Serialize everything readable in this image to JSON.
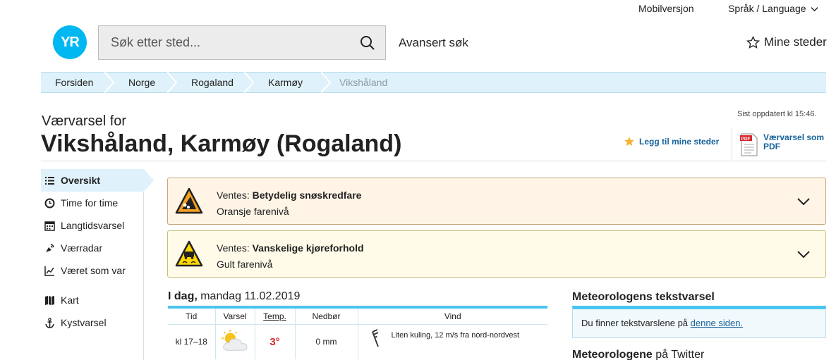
{
  "topbar": {
    "mobile": "Mobilversjon",
    "language": "Språk / Language"
  },
  "header": {
    "logo": "YR",
    "search_placeholder": "Søk etter sted...",
    "advanced_search": "Avansert søk",
    "my_places": "Mine steder"
  },
  "breadcrumb": [
    "Forsiden",
    "Norge",
    "Rogaland",
    "Karmøy",
    "Vikshåland"
  ],
  "title": {
    "prefix": "Værvarsel for",
    "place": "Vikshåland",
    "region": ", Karmøy (Rogaland)",
    "updated": "Sist oppdatert kl 15:46.",
    "add_to_my_places": "Legg til mine steder",
    "pdf": "Værvarsel som PDF"
  },
  "sidebar": {
    "items": [
      {
        "label": "Oversikt",
        "icon": "list-icon"
      },
      {
        "label": "Time for time",
        "icon": "clock-icon"
      },
      {
        "label": "Langtidsvarsel",
        "icon": "calendar-icon"
      },
      {
        "label": "Værradar",
        "icon": "radar-icon"
      },
      {
        "label": "Været som var",
        "icon": "graph-icon"
      },
      {
        "label": "Kart",
        "icon": "map-icon"
      },
      {
        "label": "Kystvarsel",
        "icon": "anchor-icon"
      }
    ]
  },
  "warnings": [
    {
      "prefix": "Ventes: ",
      "title": "Betydelig snøskredfare",
      "level": "Oransje farenivå",
      "icon": "avalanche-warning-icon",
      "color": "#f5a020"
    },
    {
      "prefix": "Ventes: ",
      "title": "Vanskelige kjøreforhold",
      "level": "Gult farenivå",
      "icon": "slippery-road-warning-icon",
      "color": "#ffd700"
    }
  ],
  "forecast": {
    "day_bold": "I dag,",
    "day_rest": " mandag 11.02.2019",
    "headers": [
      "Tid",
      "Varsel",
      "Temp.",
      "Nedbør",
      "Vind"
    ],
    "rows": [
      {
        "time": "kl 17–18",
        "symbol": "partly-cloudy-icon",
        "temp": "3°",
        "precip": "0 mm",
        "wind": "Liten kuling, 12 m/s fra nord-nordvest"
      }
    ]
  },
  "meteorologist": {
    "heading": "Meteorologens tekstvarsel",
    "text": "Du finner tekstvarslene på ",
    "link": "denne siden.",
    "twitter_bold": "Meteorologene",
    "twitter_rest": " på Twitter"
  },
  "colors": {
    "accent": "#00b8f1",
    "link": "#16639c",
    "breadcrumb_bg": "#dff1fa",
    "temp_warm": "#d9262a"
  }
}
